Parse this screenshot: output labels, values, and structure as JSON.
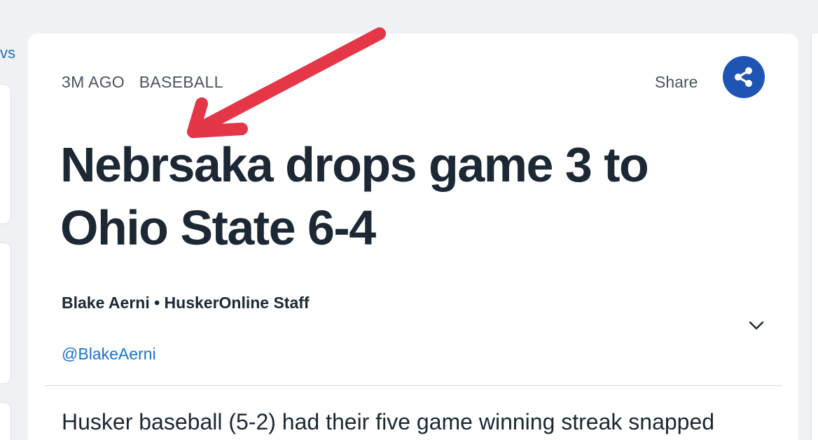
{
  "left_panel": {
    "link_text": "vs"
  },
  "article": {
    "time_ago": "3M AGO",
    "category": "BASEBALL",
    "share_label": "Share",
    "headline": "Nebrsaka drops game 3 to Ohio State 6-4",
    "byline": "Blake Aerni • HuskerOnline Staff",
    "author_handle": "@BlakeAerni",
    "body_first_line": "Husker baseball (5-2) had their five game winning streak snapped"
  },
  "colors": {
    "share_button": "#1e55b3",
    "annotation_arrow": "#e32638",
    "link": "#1a73c9",
    "headline": "#1c2834"
  },
  "icons": {
    "share": "share-icon",
    "expand": "chevron-down-icon"
  }
}
